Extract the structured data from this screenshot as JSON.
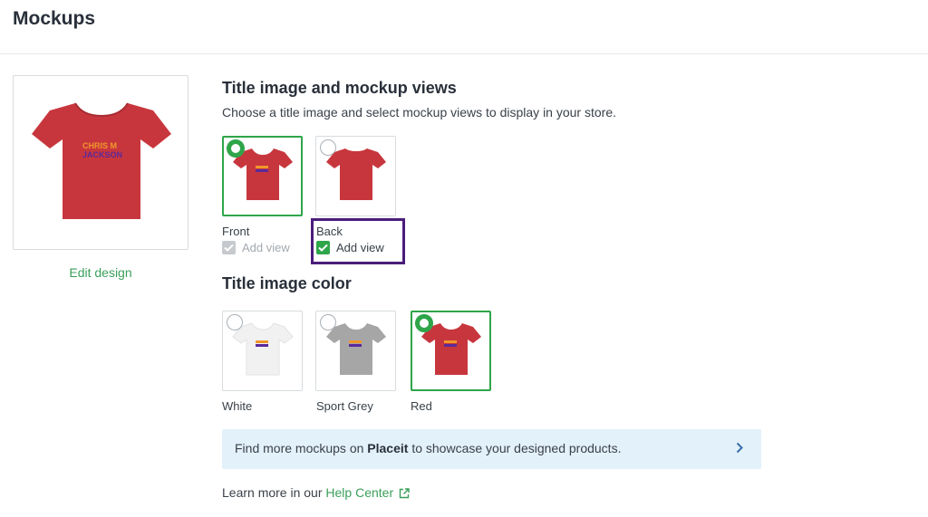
{
  "header": {
    "title": "Mockups"
  },
  "preview": {
    "edit_label": "Edit design",
    "design_text": [
      "CHRIS M",
      "JACKSON"
    ]
  },
  "views_section": {
    "title": "Title image and mockup views",
    "subtitle": "Choose a title image and select mockup views to display in your store.",
    "views": [
      {
        "label": "Front",
        "add_view_label": "Add view",
        "selected": true,
        "add_view_checked": true,
        "add_view_disabled": true
      },
      {
        "label": "Back",
        "add_view_label": "Add view",
        "selected": false,
        "add_view_checked": true,
        "add_view_disabled": false
      }
    ]
  },
  "color_section": {
    "title": "Title image color",
    "colors": [
      {
        "label": "White",
        "hex": "#f1f1f1",
        "selected": false
      },
      {
        "label": "Sport Grey",
        "hex": "#a6a6a6",
        "selected": false
      },
      {
        "label": "Red",
        "hex": "#c8363d",
        "selected": true
      }
    ]
  },
  "banner": {
    "text_before": "Find more mockups on ",
    "link": "Placeit",
    "text_after": " to showcase your designed products."
  },
  "footer": {
    "learn_text": "Learn more in our ",
    "help_link": "Help Center"
  },
  "colors": {
    "accent_green": "#2fa54a",
    "link_green": "#3a9f5a",
    "shirt_red": "#c8363d",
    "highlight_purple": "#4a1d7a",
    "banner_bg": "#e3f1fa",
    "design_orange": "#f0962a",
    "design_purple": "#5b2a9a"
  },
  "icons": {
    "radio_selected": "radio-selected-icon",
    "checkbox_checked": "checkmark-icon",
    "banner_chevron": "chevron-right-icon",
    "external_link": "external-link-icon"
  }
}
